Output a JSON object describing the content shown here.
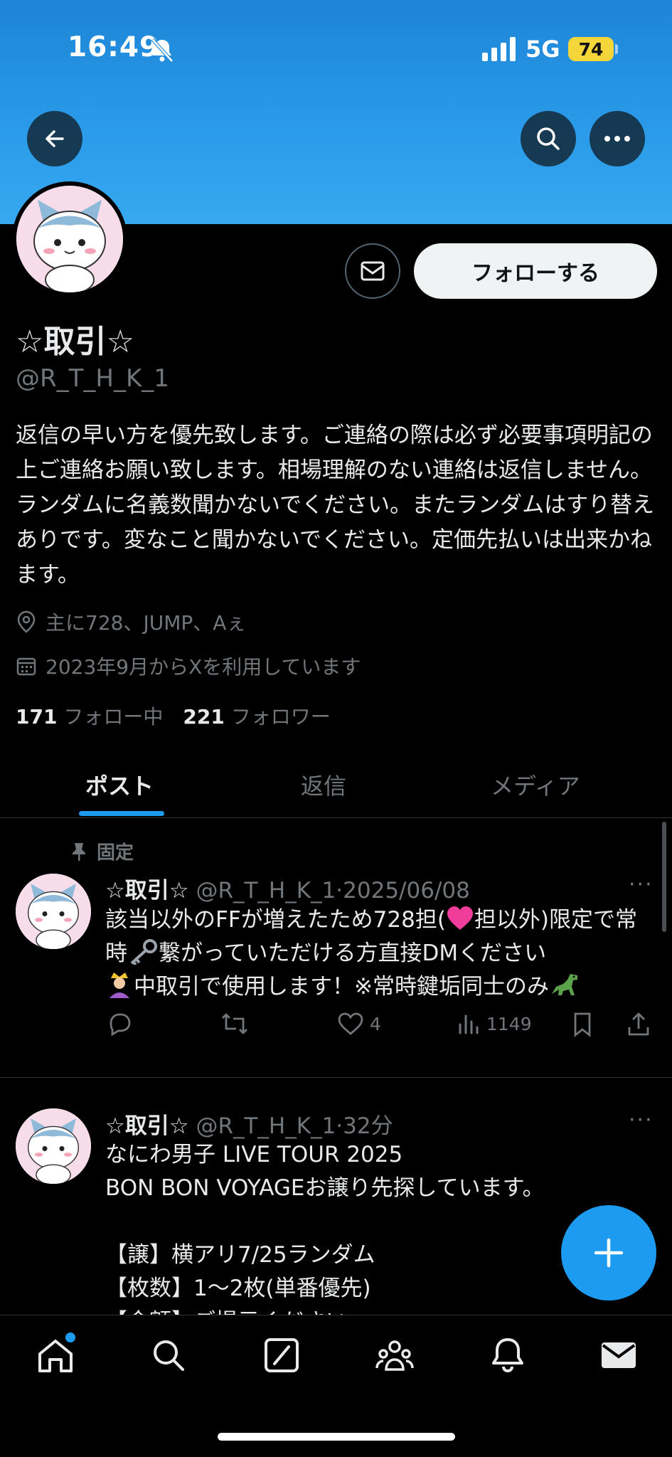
{
  "status_bar": {
    "time": "16:49",
    "network": "5G",
    "battery": "74"
  },
  "header": {
    "back_icon": "arrow-left-icon",
    "search_icon": "search-icon",
    "more_icon": "more-icon"
  },
  "profile": {
    "follow_label": "フォローする",
    "name": "☆取引☆",
    "handle": "@R_T_H_K_1",
    "bio": "返信の早い方を優先致します。ご連絡の際は必ず必要事項明記の上ご連絡お願い致します。相場理解のない連絡は返信しません。ランダムに名義数聞かないでください。またランダムはすり替えありです。変なこと聞かないでください。定価先払いは出来かねます。",
    "location": "主に728、JUMP、Aぇ",
    "joined": "2023年9月からXを利用しています",
    "following_count": "171",
    "following_label": "フォロー中",
    "followers_count": "221",
    "followers_label": "フォロワー"
  },
  "tabs": [
    {
      "label": "ポスト"
    },
    {
      "label": "返信"
    },
    {
      "label": "メディア"
    }
  ],
  "posts": [
    {
      "pinned_label": "固定",
      "name": "☆取引☆",
      "handle": "@R_T_H_K_1",
      "time": "2025/06/08",
      "text_1": "該当以外のFFが増えたため728担(",
      "text_2": "担以外)限定で常時",
      "text_3": "繋がっていただける方直接DMください",
      "text_4": "中取引で使用します！※常時鍵垢同士のみ",
      "likes": "4",
      "views": "1149"
    },
    {
      "name": "☆取引☆",
      "handle": "@R_T_H_K_1",
      "time": "32分",
      "line_1": "なにわ男子 LIVE TOUR 2025",
      "line_2": "BON BON VOYAGEお譲り先探しています。",
      "line_3": "【譲】横アリ7/25ランダム",
      "line_4": "【枚数】1〜2枚(単番優先)",
      "line_5": "【金額】ご提示ください"
    }
  ],
  "colors": {
    "accent": "#1d9bf0",
    "banner": "#2a9ae8",
    "background": "#000000",
    "text": "#e7e9ea",
    "muted": "#71767b"
  }
}
